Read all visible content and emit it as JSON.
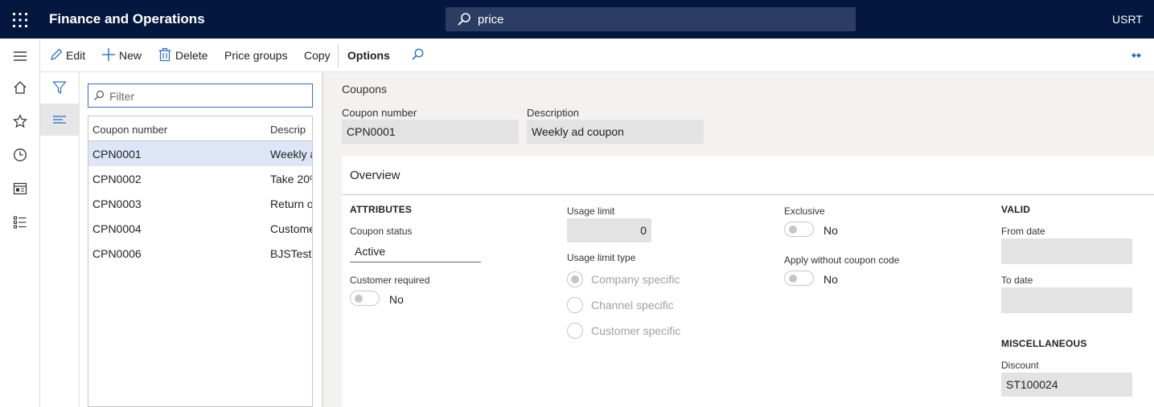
{
  "app": {
    "title": "Finance and Operations",
    "company": "USRT"
  },
  "search": {
    "value": "price"
  },
  "actions": {
    "edit": "Edit",
    "new": "New",
    "delete": "Delete",
    "price_groups": "Price groups",
    "copy": "Copy",
    "options": "Options"
  },
  "list": {
    "filter_placeholder": "Filter",
    "columns": [
      "Coupon number",
      "Descrip"
    ],
    "rows": [
      {
        "number": "CPN0001",
        "desc": "Weekly a"
      },
      {
        "number": "CPN0002",
        "desc": "Take 20%"
      },
      {
        "number": "CPN0003",
        "desc": "Return o"
      },
      {
        "number": "CPN0004",
        "desc": "Custome"
      },
      {
        "number": "CPN0006",
        "desc": "BJSTestC"
      }
    ]
  },
  "details": {
    "caption": "Coupons",
    "coupon_number_label": "Coupon number",
    "coupon_number": "CPN0001",
    "description_label": "Description",
    "description": "Weekly ad coupon",
    "overview_title": "Overview",
    "attributes": {
      "header": "ATTRIBUTES",
      "status_label": "Coupon status",
      "status": "Active",
      "customer_required_label": "Customer required",
      "customer_required": "No"
    },
    "usage": {
      "limit_label": "Usage limit",
      "limit": "0",
      "type_label": "Usage limit type",
      "options": [
        "Company specific",
        "Channel specific",
        "Customer specific"
      ]
    },
    "flags": {
      "exclusive_label": "Exclusive",
      "exclusive": "No",
      "apply_without_label": "Apply without coupon code",
      "apply_without": "No"
    },
    "valid": {
      "header": "VALID",
      "from_label": "From date",
      "from": "",
      "to_label": "To date",
      "to": ""
    },
    "misc": {
      "header": "MISCELLANEOUS",
      "discount_label": "Discount",
      "discount": "ST100024"
    }
  },
  "colors": {
    "topbar": "#04173f",
    "accent": "#2f6fc0",
    "selected_row": "#dce6f7"
  },
  "icons": [
    "waffle-icon",
    "search-icon",
    "edit-icon",
    "add-icon",
    "delete-icon",
    "collapse-icon",
    "menu-icon",
    "home-icon",
    "star-icon",
    "clock-icon",
    "workspace-icon",
    "list-modules-icon",
    "funnel-icon",
    "list-lines-icon"
  ]
}
